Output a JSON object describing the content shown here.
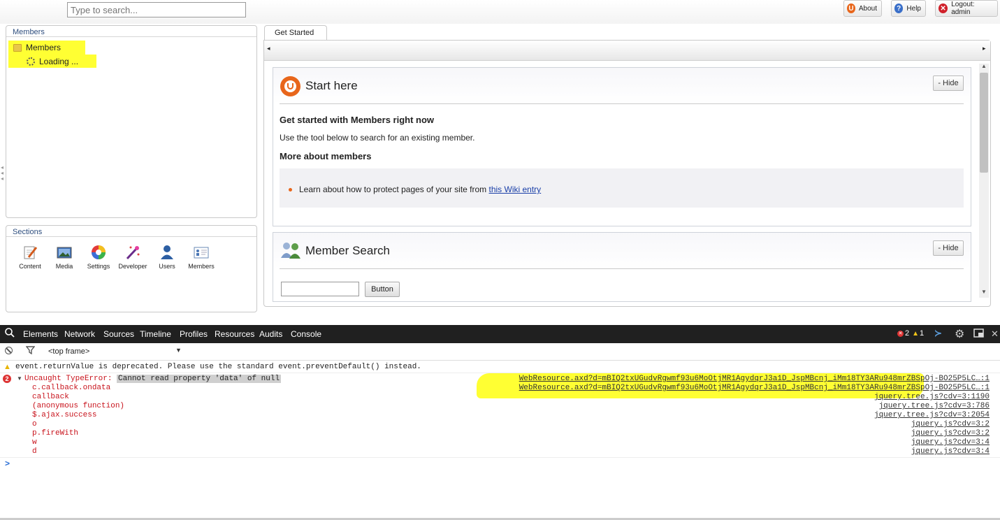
{
  "topbar": {
    "search_placeholder": "Type to search...",
    "about_label": "About",
    "help_label": "Help",
    "logout_label": "Logout: admin"
  },
  "tree_panel": {
    "title": "Members",
    "root_label": "Members",
    "loading_label": "Loading ..."
  },
  "sections_panel": {
    "title": "Sections",
    "items": [
      {
        "label": "Content",
        "icon": "pencil-document-icon"
      },
      {
        "label": "Media",
        "icon": "picture-icon"
      },
      {
        "label": "Settings",
        "icon": "color-wheel-icon"
      },
      {
        "label": "Developer",
        "icon": "magic-wand-icon"
      },
      {
        "label": "Users",
        "icon": "user-icon"
      },
      {
        "label": "Members",
        "icon": "members-card-icon"
      }
    ]
  },
  "content": {
    "tab_label": "Get Started",
    "start_here": {
      "title": "Start here",
      "hide_label": "- Hide",
      "heading1": "Get started with Members right now",
      "text1": "Use the tool below to search for an existing member.",
      "heading2": "More about members",
      "bullet_text": "Learn about how to protect pages of your site from ",
      "bullet_link": "this Wiki entry"
    },
    "member_search": {
      "title": "Member Search",
      "hide_label": "- Hide",
      "input_value": "",
      "button_label": "Button"
    }
  },
  "devtools": {
    "tabs": [
      "Elements",
      "Network",
      "Sources",
      "Timeline",
      "Profiles",
      "Resources",
      "Audits",
      "Console"
    ],
    "error_count": "2",
    "warning_count": "1",
    "frame_selector": "<top frame>",
    "warning_message": "event.returnValue is deprecated. Please use the standard event.preventDefault() instead.",
    "error_badge": "2",
    "error_prefix": "Uncaught TypeError: ",
    "error_message": "Cannot read property 'data' of null",
    "stack": [
      {
        "fn": "c.callback.ondata",
        "src": "WebResource.axd?d=mBIQ2txUGudvRgwmf93u6MoOtjMR1AgydqrJ3a1D_JspMBcnj_iMm18TY3ARu948mrZBSpOj-BO25P5LC…:1"
      },
      {
        "fn": "callback",
        "src": "WebResource.axd?d=mBIQ2txUGudvRgwmf93u6MoOtjMR1AgydqrJ3a1D_JspMBcnj_iMm18TY3ARu948mrZBSpOj-BO25P5LC…:1"
      },
      {
        "fn": "(anonymous function)",
        "src": "jquery.tree.js?cdv=3:1190"
      },
      {
        "fn": "$.ajax.success",
        "src": "jquery.tree.js?cdv=3:786"
      },
      {
        "fn": "o",
        "src": "jquery.tree.js?cdv=3:2054"
      },
      {
        "fn": "p.fireWith",
        "src": "jquery.js?cdv=3:2"
      },
      {
        "fn": "w",
        "src": "jquery.js?cdv=3:2"
      },
      {
        "fn": "d",
        "src": "jquery.js?cdv=3:4"
      },
      {
        "fn": "",
        "src": "jquery.js?cdv=3:4"
      }
    ],
    "prompt": ">"
  }
}
